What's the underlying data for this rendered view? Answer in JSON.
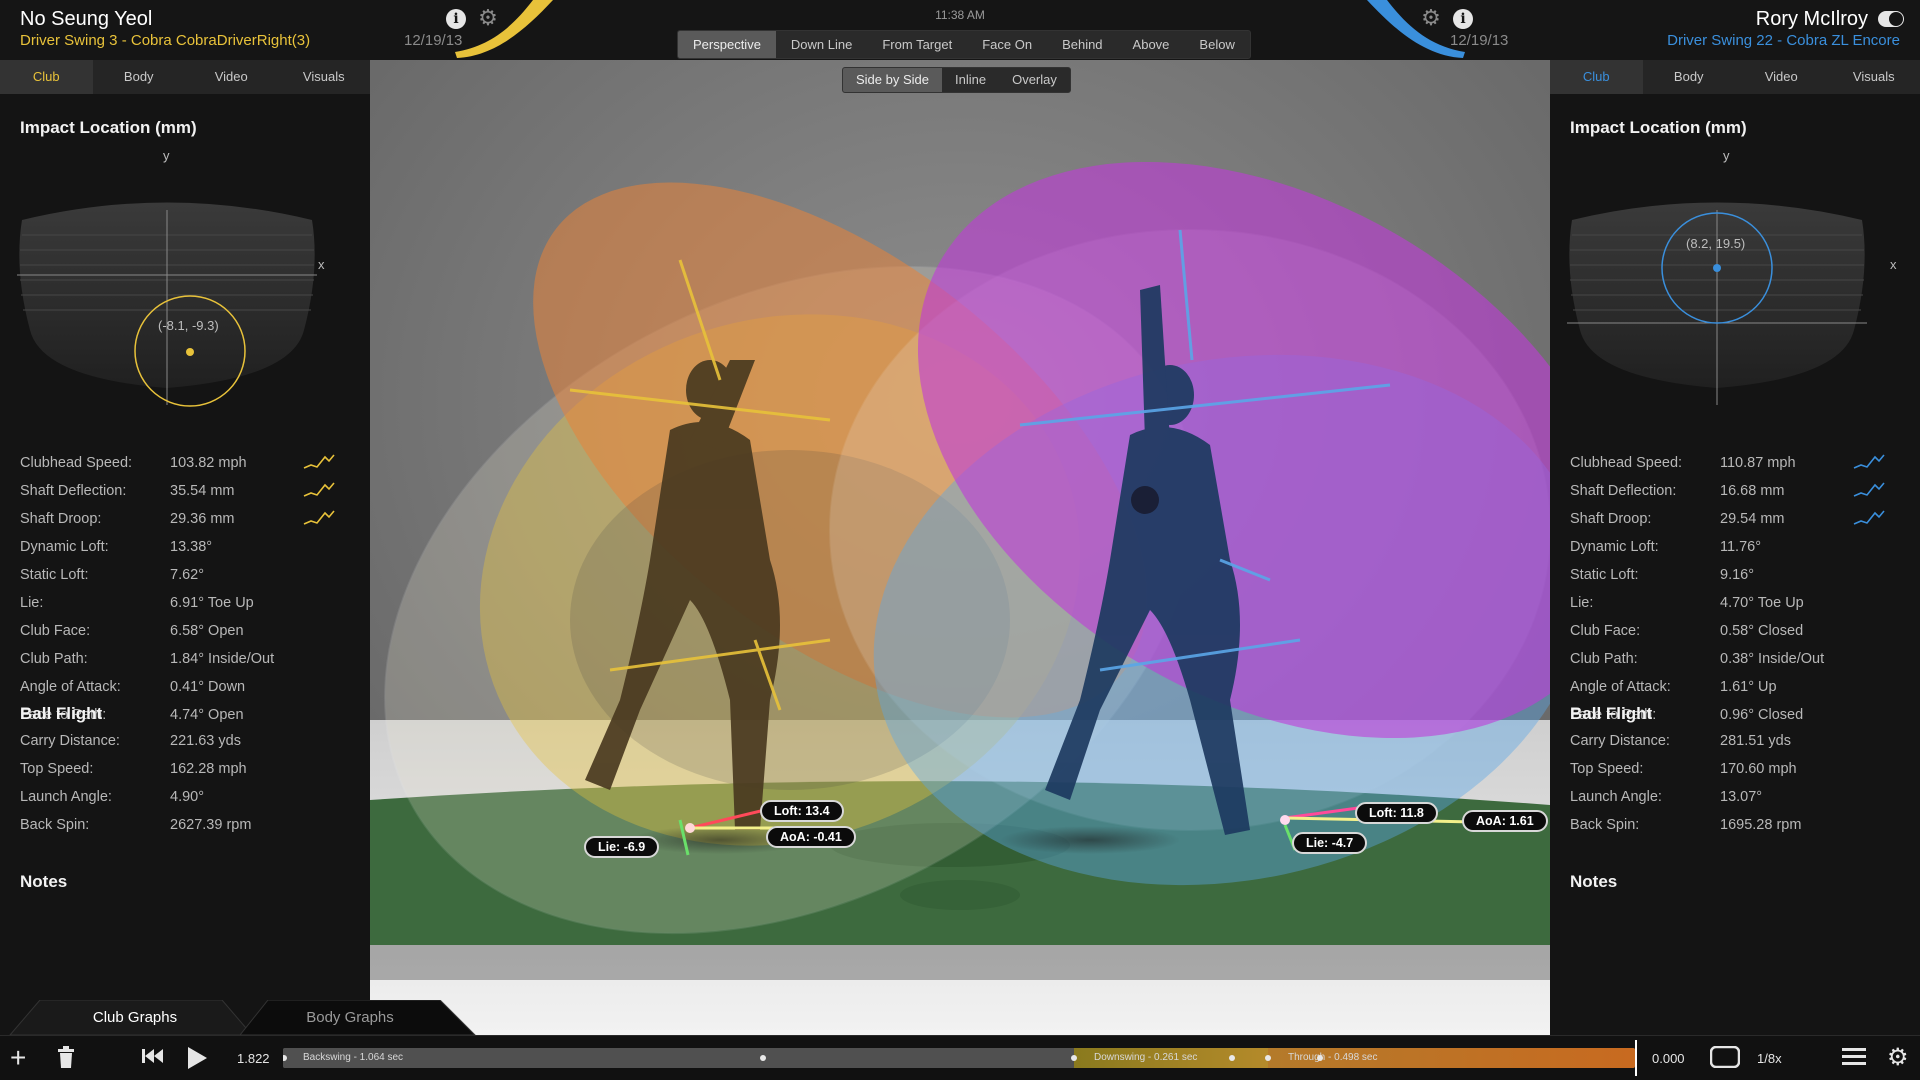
{
  "header": {
    "time": "11:38 AM",
    "left_player": {
      "name": "No Seung Yeol",
      "swing": "Driver Swing 3 - Cobra CobraDriverRight(3)",
      "date": "12/19/13",
      "accent": "#e8c23a"
    },
    "right_player": {
      "name": "Rory McIlroy",
      "swing": "Driver Swing 22 - Cobra ZL Encore",
      "date": "12/19/13",
      "accent": "#3a8fdc"
    },
    "view_tabs": [
      "Perspective",
      "Down Line",
      "From Target",
      "Face On",
      "Behind",
      "Above",
      "Below"
    ],
    "view_active": "Perspective",
    "mode_tabs": [
      "Side by Side",
      "Inline",
      "Overlay"
    ],
    "mode_active": "Side by Side"
  },
  "panel_tabs": [
    "Club",
    "Body",
    "Video",
    "Visuals"
  ],
  "left_panel": {
    "impact_title": "Impact Location (mm)",
    "impact_label": "(-8.1, -9.3)",
    "axis_x": "x",
    "axis_y": "y",
    "metrics": [
      {
        "label": "Clubhead Speed:",
        "value": "103.82 mph",
        "graph": true
      },
      {
        "label": "Shaft Deflection:",
        "value": "35.54 mm",
        "graph": true
      },
      {
        "label": "Shaft Droop:",
        "value": "29.36 mm",
        "graph": true
      },
      {
        "label": "Dynamic Loft:",
        "value": "13.38°"
      },
      {
        "label": "Static Loft:",
        "value": "7.62°"
      },
      {
        "label": "Lie:",
        "value": "6.91° Toe Up"
      },
      {
        "label": "Club Face:",
        "value": "6.58° Open"
      },
      {
        "label": "Club Path:",
        "value": "1.84° Inside/Out"
      },
      {
        "label": "Angle of Attack:",
        "value": "0.41° Down"
      },
      {
        "label": "Face to Path:",
        "value": "4.74° Open"
      }
    ],
    "ball_flight_title": "Ball Flight",
    "ball_flight": [
      {
        "label": "Carry Distance:",
        "value": "221.63 yds"
      },
      {
        "label": "Top Speed:",
        "value": "162.28 mph"
      },
      {
        "label": "Launch Angle:",
        "value": "4.90°"
      },
      {
        "label": "Back Spin:",
        "value": "2627.39 rpm"
      }
    ],
    "notes_title": "Notes"
  },
  "right_panel": {
    "impact_title": "Impact Location (mm)",
    "impact_label": "(8.2, 19.5)",
    "axis_x": "x",
    "axis_y": "y",
    "metrics": [
      {
        "label": "Clubhead Speed:",
        "value": "110.87 mph",
        "graph": true
      },
      {
        "label": "Shaft Deflection:",
        "value": "16.68 mm",
        "graph": true
      },
      {
        "label": "Shaft Droop:",
        "value": "29.54 mm",
        "graph": true
      },
      {
        "label": "Dynamic Loft:",
        "value": "11.76°"
      },
      {
        "label": "Static Loft:",
        "value": "9.16°"
      },
      {
        "label": "Lie:",
        "value": "4.70° Toe Up"
      },
      {
        "label": "Club Face:",
        "value": "0.58° Closed"
      },
      {
        "label": "Club Path:",
        "value": "0.38° Inside/Out"
      },
      {
        "label": "Angle of Attack:",
        "value": "1.61° Up"
      },
      {
        "label": "Face to Path:",
        "value": "0.96° Closed"
      }
    ],
    "ball_flight_title": "Ball Flight",
    "ball_flight": [
      {
        "label": "Carry Distance:",
        "value": "281.51 yds"
      },
      {
        "label": "Top Speed:",
        "value": "170.60 mph"
      },
      {
        "label": "Launch Angle:",
        "value": "13.07°"
      },
      {
        "label": "Back Spin:",
        "value": "1695.28 rpm"
      }
    ],
    "notes_title": "Notes"
  },
  "viewport": {
    "left_badges": {
      "loft": "Loft: 13.4",
      "aoa": "AoA: -0.41",
      "lie": "Lie: -6.9"
    },
    "right_badges": {
      "loft": "Loft: 11.8",
      "aoa": "AoA: 1.61",
      "lie": "Lie: -4.7"
    },
    "colors": {
      "left_plane": "#e8c23a",
      "left_arc": "#e8843a",
      "right_plane": "#5aa6e8",
      "right_arc": "#c03ad8",
      "ground": "#3d6a3e"
    }
  },
  "bottom": {
    "graph_tabs": [
      "Club Graphs",
      "Body Graphs"
    ],
    "graph_active": "Club Graphs",
    "time_current": "1.822",
    "time_end": "0.000",
    "speed": "1/8x",
    "timeline": {
      "backswing": "Backswing - 1.064 sec",
      "downswing": "Downswing - 0.261 sec",
      "through": "Through - 0.498 sec"
    },
    "icons": [
      "plus-icon",
      "trash-icon",
      "skip-back-icon",
      "play-icon",
      "fullscreen-icon",
      "menu-icon",
      "gear-icon"
    ]
  }
}
